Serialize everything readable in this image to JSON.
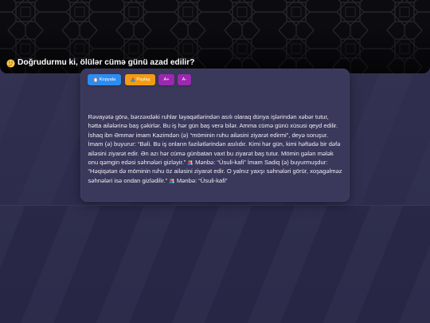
{
  "header": {
    "title_icon": "thinking-face-icon",
    "title": "Doğrudurmu ki, ölülər cümə günü azad edilir?"
  },
  "toolbar": {
    "copy": {
      "icon": "clipboard-icon",
      "label": "Kopyala",
      "color": "#2d8cf0"
    },
    "share": {
      "icon": "outbox-tray-icon",
      "label": "Paylaş",
      "color": "#f39c12"
    },
    "font_increase": {
      "label": "A+",
      "color": "#9c27b0"
    },
    "font_decrease": {
      "label": "A-",
      "color": "#9c27b0"
    }
  },
  "article": {
    "lines": [
      [
        {
          "text": "Rəvayətə görə, bərzəxdəki ruhlar ləyaqətlərindən asılı olaraq dünya işlərindən xəbər tutur,"
        }
      ],
      [
        {
          "text": "hətta ailələrinə baş çəkirlər. Bu iş hər gün baş verə bilər. Amma cümə günü xüsusi qeyd edilir."
        }
      ],
      [
        {
          "text": "İshaq ibn Əmmar imam Kazimdən (ə) “möminin ruhu ailəsini ziyarət edirmi”, deyə soruşur."
        }
      ],
      [
        {
          "text": "İmam (ə) buyurur: “Bəli. Bu iş onların fəzilətlərindən asılıdır. Kimi hər gün, kimi həftədə bir dəfə"
        }
      ],
      [
        {
          "text": "ailəsini ziyarət edir. Ən azı hər cümə günbatan vaxt bu ziyarət baş tutur. Mömin gələn mələk"
        }
      ],
      [
        {
          "text": "onu qəmgin edəsi səhnələri gizləyir.” "
        },
        {
          "icon": "books-icon"
        },
        {
          "text": " Mənbə: “Üsuli-kafi” İmam Sadiq (ə) buyurmuşdur:"
        }
      ],
      [
        {
          "text": "“Həqiqətən də möminin ruhu öz ailəsini ziyarət edir. O yalnız yaxşı səhnələri görür, xoşagəlməz"
        }
      ],
      [
        {
          "text": "səhnələri isə ondan gizlədilir.” "
        },
        {
          "icon": "books-icon"
        },
        {
          "text": " Mənbə: “Üsuli-kafi”"
        }
      ]
    ]
  }
}
